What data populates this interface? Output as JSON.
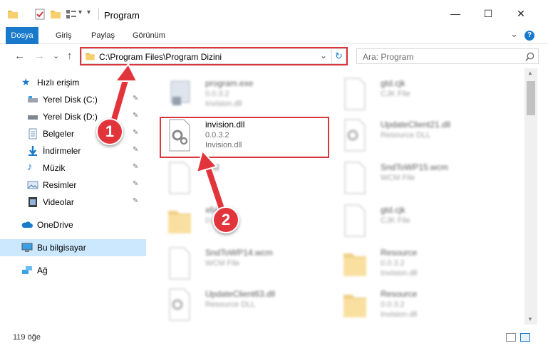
{
  "window": {
    "title": "Program",
    "minimize_glyph": "—",
    "maximize_glyph": "☐",
    "close_glyph": "✕"
  },
  "ribbon": {
    "tabs": [
      "Dosya",
      "Giriş",
      "Paylaş",
      "Görünüm"
    ],
    "expand_glyph": "⌄",
    "help_glyph": "?"
  },
  "nav": {
    "back": "←",
    "forward": "→",
    "recent": "⌄",
    "up": "↑",
    "address": "C:\\Program Files\\Program Dizini",
    "address_dropdown": "⌄",
    "refresh": "↻",
    "search_placeholder": "Ara: Program"
  },
  "sidebar": {
    "items": [
      {
        "label": "Hızlı erişim",
        "icon": "star-icon"
      },
      {
        "label": "Yerel Disk (C:)",
        "icon": "drive-icon",
        "pinned": true
      },
      {
        "label": "Yerel Disk (D:)",
        "icon": "drive-icon",
        "pinned": true
      },
      {
        "label": "Belgeler",
        "icon": "documents-icon",
        "pinned": true
      },
      {
        "label": "İndirmeler",
        "icon": "downloads-icon",
        "pinned": true
      },
      {
        "label": "Müzik",
        "icon": "music-icon",
        "pinned": true
      },
      {
        "label": "Resimler",
        "icon": "pictures-icon",
        "pinned": true
      },
      {
        "label": "Videolar",
        "icon": "videos-icon",
        "pinned": true
      },
      {
        "label": "OneDrive",
        "icon": "cloud-icon"
      },
      {
        "label": "Bu bilgisayar",
        "icon": "computer-icon",
        "selected": true
      },
      {
        "label": "Ağ",
        "icon": "network-icon"
      }
    ],
    "pin_glyph": "📌"
  },
  "files": [
    {
      "name": "program.exe",
      "sub1": "0.0.3.2",
      "sub2": "Invision.dll",
      "type": "exe",
      "blurred": true
    },
    {
      "name": "gtd.cjk",
      "sub1": "CJK File",
      "sub2": "",
      "type": "file",
      "blurred": true
    },
    {
      "name": "invision.dll",
      "sub1": "0.0.3.2",
      "sub2": "Invision.dll",
      "type": "dll",
      "blurred": false
    },
    {
      "name": "UpdateClient21.dll",
      "sub1": "Resource DLL",
      "sub2": "",
      "type": "dll",
      "blurred": true
    },
    {
      "name": "Gtd",
      "sub1": "",
      "sub2": "",
      "type": "file",
      "blurred": true
    },
    {
      "name": "SndToWP15.wcm",
      "sub1": "WCM File",
      "sub2": "",
      "type": "file",
      "blurred": true
    },
    {
      "name": "x64",
      "sub1": "0.0.",
      "sub2": "",
      "type": "folder",
      "blurred": true
    },
    {
      "name": "gtd.cjk",
      "sub1": "CJK File",
      "sub2": "",
      "type": "file",
      "blurred": true
    },
    {
      "name": "SndToWP14.wcm",
      "sub1": "WCM File",
      "sub2": "",
      "type": "file",
      "blurred": true
    },
    {
      "name": "Resource",
      "sub1": "0.0.3.2",
      "sub2": "Invision.dll",
      "type": "folder",
      "blurred": true
    },
    {
      "name": "UpdateClient63.dll",
      "sub1": "Resource DLL",
      "sub2": "",
      "type": "dll",
      "blurred": true
    },
    {
      "name": "Resource",
      "sub1": "0.0.3.2",
      "sub2": "Invision.dll",
      "type": "folder",
      "blurred": true
    }
  ],
  "status": {
    "count": "119 öğe"
  },
  "callouts": [
    "1",
    "2"
  ],
  "colors": {
    "accent": "#1979ca",
    "highlight": "#d9363e",
    "selected": "#cce8ff"
  }
}
